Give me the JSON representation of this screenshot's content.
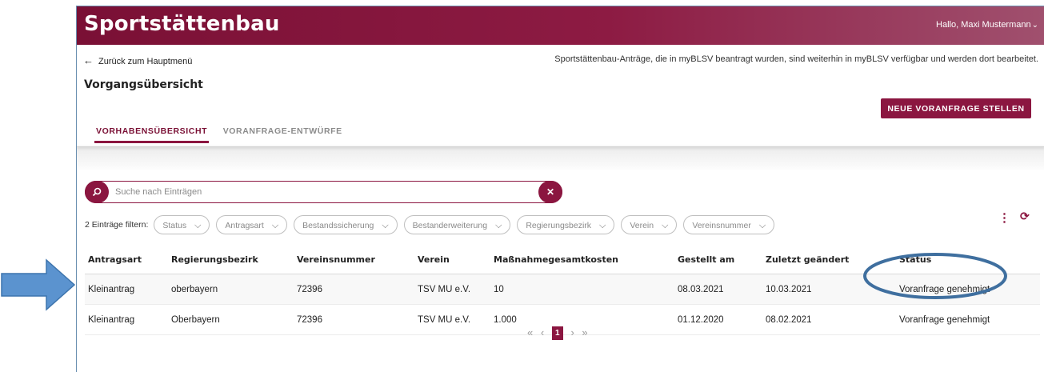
{
  "header": {
    "brand": "Sportstättenbau",
    "user": "Hallo, Maxi Mustermann",
    "user_chevron": "chevron-down-icon"
  },
  "back_link": "Zurück zum Hauptmenü",
  "notice": "Sportstättenbau-Anträge, die in myBLSV beantragt wurden, sind weiterhin in myBLSV verfügbar und werden dort bearbeitet.",
  "page_title": "Vorgangsübersicht",
  "new_button": "NEUE VORANFRAGE STELLEN",
  "tabs": [
    {
      "label": "VORHABENSÜBERSICHT",
      "active": true
    },
    {
      "label": "VORANFRAGE-ENTWÜRFE",
      "active": false
    }
  ],
  "search": {
    "placeholder": "Suche nach Einträgen"
  },
  "filters": {
    "label": "2 Einträge filtern:",
    "chips": [
      "Status",
      "Antragsart",
      "Bestandssicherung",
      "Bestanderweiterung",
      "Regierungsbezirk",
      "Verein",
      "Vereinsnummer"
    ]
  },
  "table": {
    "columns": [
      "Antragsart",
      "Regierungsbezirk",
      "Vereinsnummer",
      "Verein",
      "Maßnahmegesamtkosten",
      "Gestellt am",
      "Zuletzt geändert",
      "Status"
    ],
    "rows": [
      [
        "Kleinantrag",
        "oberbayern",
        "72396",
        "TSV MU e.V.",
        "10",
        "08.03.2021",
        "10.03.2021",
        "Voranfrage genehmigt"
      ],
      [
        "Kleinantrag",
        "Oberbayern",
        "72396",
        "TSV MU e.V.",
        "1.000",
        "01.12.2020",
        "08.02.2021",
        "Voranfrage genehmigt"
      ]
    ]
  },
  "pager": {
    "first": "«",
    "prev": "‹",
    "current": "1",
    "next": "›",
    "last": "»"
  },
  "colors": {
    "brand": "#8b1640",
    "annotation": "#3f6f9f",
    "arrow": "#5b93cf"
  }
}
